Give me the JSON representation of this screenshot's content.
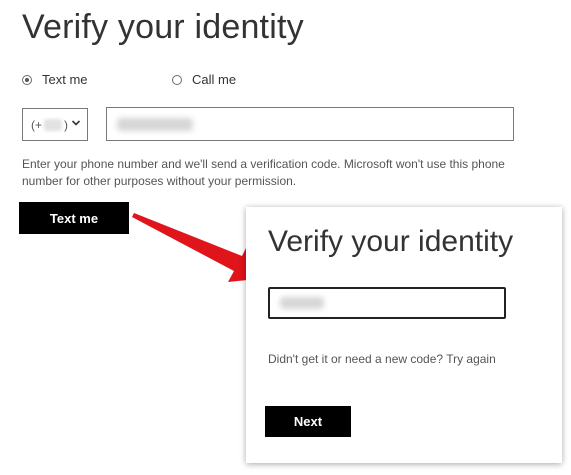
{
  "main": {
    "title": "Verify your identity",
    "radio_options": [
      {
        "label": "Text me",
        "checked": true
      },
      {
        "label": "Call me",
        "checked": false
      }
    ],
    "country_code_prefix": "(+",
    "country_code_suffix": ")",
    "help_text": "Enter your phone number and we'll send a verification code. Microsoft won't use this phone number for other purposes without your permission.",
    "text_me_button": "Text me"
  },
  "popup": {
    "title": "Verify your identity",
    "retry_text": "Didn't get it or need a new code? Try again",
    "next_button": "Next"
  },
  "colors": {
    "button_bg": "#000000",
    "arrow": "#e0141b"
  },
  "icons": [
    "chevron-down-icon",
    "arrow-pointer"
  ]
}
